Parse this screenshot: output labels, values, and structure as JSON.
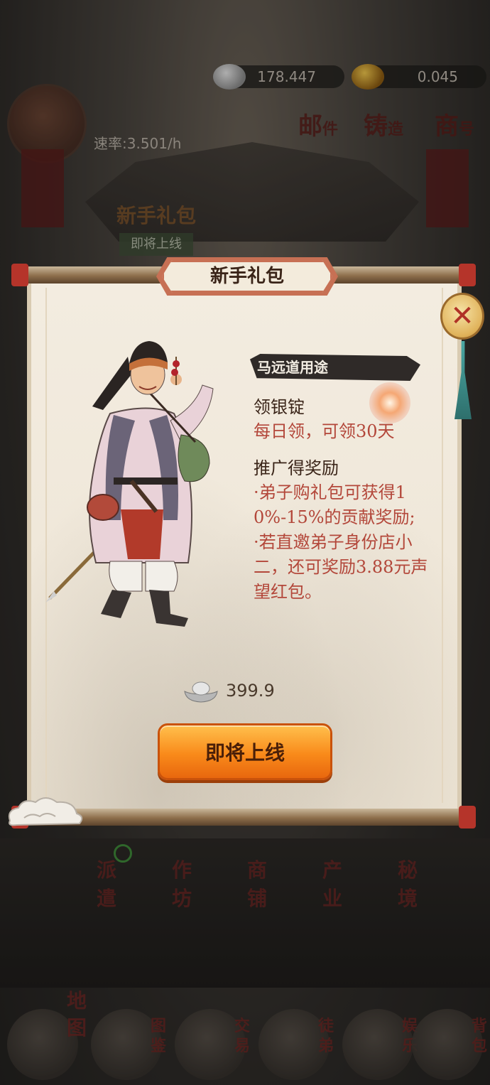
{
  "resources": {
    "silver": "178.447",
    "gold": "0.045"
  },
  "rate": "速率:3.501/h",
  "top_menu": [
    {
      "main": "邮",
      "sub": "件"
    },
    {
      "main": "铸",
      "sub": "造"
    },
    {
      "main": "商",
      "sub": "号"
    }
  ],
  "background_gift": {
    "title": "新手礼包",
    "button": "即将上线"
  },
  "modal": {
    "title": "新手礼包",
    "tag": "马远道用途",
    "section1_title": "领银锭",
    "section1_desc": "每日领，可领30天",
    "section2_title": "推广得奖励",
    "section2_point1": "·弟子购礼包可获得10%-15%的贡献奖励;",
    "section2_point2": "·若直邀弟子身份店小二，还可奖励3.88元声望红包。",
    "price": "399.9",
    "action_button": "即将上线",
    "close_label": "✕"
  },
  "mid_menu": [
    {
      "label": "派遣"
    },
    {
      "label": "作坊"
    },
    {
      "label": "商铺"
    },
    {
      "label": "产业"
    },
    {
      "label": "秘境"
    }
  ],
  "bottom_nav": [
    {
      "label": "地图"
    },
    {
      "label": "图鉴"
    },
    {
      "label": "交易"
    },
    {
      "label": "徒弟"
    },
    {
      "label": "娱乐"
    },
    {
      "label": "背包"
    }
  ],
  "colors": {
    "accent_orange": "#f98a1a",
    "text_red": "#b3473a",
    "title_border": "#c77054",
    "paper": "#f3ece0"
  },
  "icons": {
    "silver": "silver-ingot-icon",
    "gold": "gold-ingot-icon",
    "close": "close-icon",
    "cloud": "cloud-icon"
  }
}
